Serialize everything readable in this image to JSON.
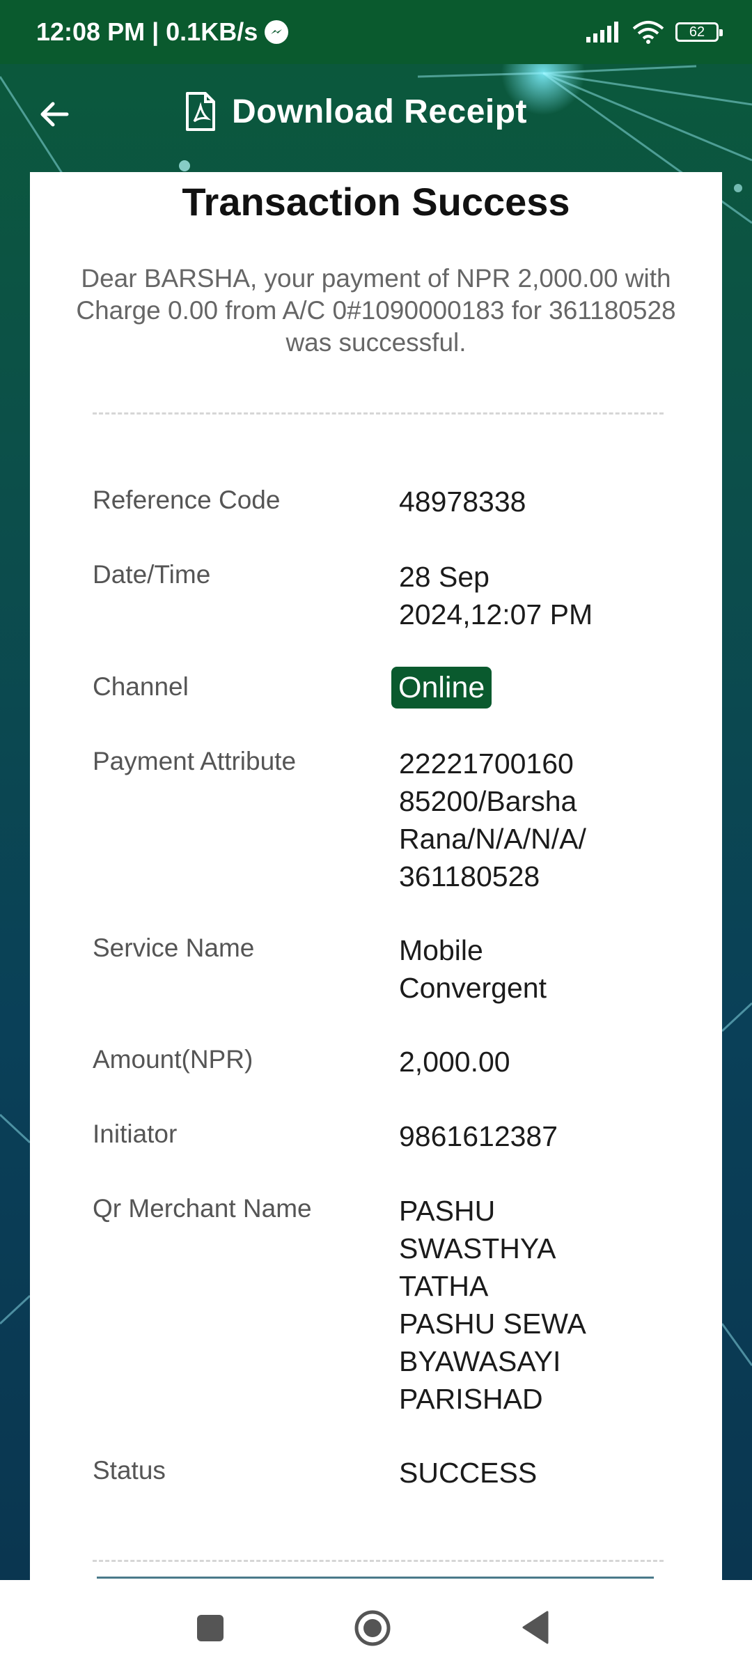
{
  "status_bar": {
    "time_speed": "12:08 PM | 0.1KB/s",
    "battery": "62"
  },
  "header": {
    "title": "Download Receipt"
  },
  "receipt": {
    "title": "Transaction Success",
    "message": "Dear BARSHA, your payment of NPR 2,000.00 with Charge 0.00 from A/C 0#1090000183 for 361180528 was successful.",
    "rows": [
      {
        "label": "Reference Code",
        "value": "48978338"
      },
      {
        "label": "Date/Time",
        "value": "28 Sep\n2024,12:07 PM"
      },
      {
        "label": "Channel",
        "value": "Online"
      },
      {
        "label": "Payment Attribute",
        "value": "22221700160\n85200/Barsha\nRana/N/A/N/A/\n361180528"
      },
      {
        "label": "Service Name",
        "value": "Mobile\nConvergent"
      },
      {
        "label": "Amount(NPR)",
        "value": "2,000.00"
      },
      {
        "label": "Initiator",
        "value": "9861612387"
      },
      {
        "label": "Qr Merchant Name",
        "value": "PASHU\nSWASTHYA\nTATHA\nPASHU SEWA\nBYAWASAYI\nPARISHAD"
      },
      {
        "label": "Status",
        "value": "SUCCESS"
      }
    ]
  },
  "colors": {
    "primary_green": "#0a5a2e",
    "card_bg": "#ffffff"
  },
  "icons": {
    "back": "arrow-left-icon",
    "pdf": "pdf-file-icon",
    "messenger": "messenger-icon",
    "signal": "signal-icon",
    "wifi": "wifi-icon"
  }
}
